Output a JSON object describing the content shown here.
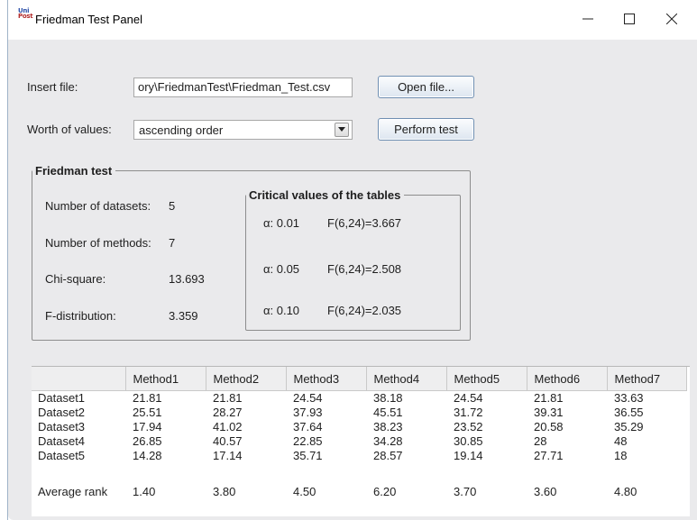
{
  "window": {
    "title": "Friedman Test Panel",
    "icon_text_line1": "Uni",
    "icon_text_line2": "Post",
    "controls": [
      "minimize-icon",
      "maximize-icon",
      "close-icon"
    ]
  },
  "form": {
    "insert_file_label": "Insert file:",
    "file_path_value": "ory\\FriedmanTest\\Friedman_Test.csv",
    "open_file_button": "Open file...",
    "worth_label": "Worth of values:",
    "worth_selected": "ascending order",
    "perform_button": "Perform test"
  },
  "friedman": {
    "title": "Friedman test",
    "datasets_label": "Number of datasets:",
    "datasets_value": "5",
    "methods_label": "Number of methods:",
    "methods_value": "7",
    "chi_label": "Chi-square:",
    "chi_value": "13.693",
    "f_label": "F-distribution:",
    "f_value": "3.359"
  },
  "critical": {
    "title": "Critical values of the tables",
    "rows": [
      {
        "alpha": "α: 0.01",
        "value": "F(6,24)=3.667"
      },
      {
        "alpha": "α: 0.05",
        "value": "F(6,24)=2.508"
      },
      {
        "alpha": "α: 0.10",
        "value": "F(6,24)=2.035"
      }
    ]
  },
  "table": {
    "headers": [
      "",
      "Method1",
      "Method2",
      "Method3",
      "Method4",
      "Method5",
      "Method6",
      "Method7"
    ],
    "rows": [
      [
        "Dataset1",
        "21.81",
        "21.81",
        "24.54",
        "38.18",
        "24.54",
        "21.81",
        "33.63"
      ],
      [
        "Dataset2",
        "25.51",
        "28.27",
        "37.93",
        "45.51",
        "31.72",
        "39.31",
        "36.55"
      ],
      [
        "Dataset3",
        "17.94",
        "41.02",
        "37.64",
        "38.23",
        "23.52",
        "20.58",
        "35.29"
      ],
      [
        "Dataset4",
        "26.85",
        "40.57",
        "22.85",
        "34.28",
        "30.85",
        "28",
        "48"
      ],
      [
        "Dataset5",
        "14.28",
        "17.14",
        "35.71",
        "28.57",
        "19.14",
        "27.71",
        "18"
      ]
    ],
    "average": [
      "Average rank",
      "1.40",
      "3.80",
      "4.50",
      "6.20",
      "3.70",
      "3.60",
      "4.80"
    ]
  }
}
